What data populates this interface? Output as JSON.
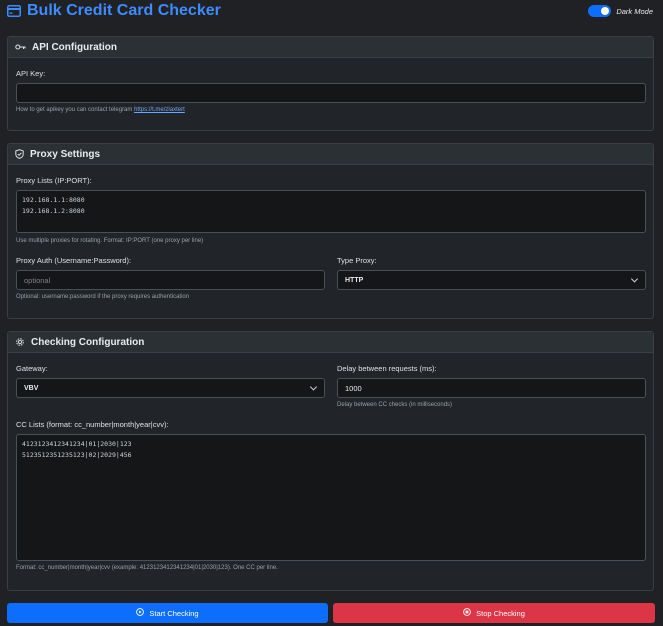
{
  "header": {
    "title": "Bulk Credit Card Checker",
    "dark_mode_label": "Dark Mode",
    "dark_mode_on": true
  },
  "api": {
    "title": "API Configuration",
    "key_label": "API Key:",
    "key_value": "",
    "help_text": "How to get apikey you can contact telegram ",
    "help_link": "https://t.me/zlaxtert"
  },
  "proxy": {
    "title": "Proxy Settings",
    "lists_label": "Proxy Lists (IP:PORT):",
    "lists_value": "192.168.1.1:8080\n192.168.1.2:8080",
    "lists_help": "Use multiple proxies for rotating. Format: IP:PORT (one proxy per line)",
    "auth_label": "Proxy Auth (Username:Password):",
    "auth_placeholder": "optional",
    "auth_help": "Optional: username:password if the proxy requires authentication",
    "type_label": "Type Proxy:",
    "type_value": "HTTP"
  },
  "checking": {
    "title": "Checking Configuration",
    "gateway_label": "Gateway:",
    "gateway_value": "VBV",
    "delay_label": "Delay between requests (ms):",
    "delay_value": "1000",
    "delay_help": "Delay between CC checks (in milliseconds)",
    "cc_label": "CC Lists (format: cc_number|month|year|cvv):",
    "cc_value": "4123123412341234|01|2030|123\n5123512351235123|02|2029|456",
    "cc_help": "Format: cc_number|month|year|cvv (example: 4123123412341234|01|2030|123). One CC per line."
  },
  "actions": {
    "start_label": "Start Checking",
    "stop_label": "Stop Checking"
  },
  "colors": {
    "accent": "#0d6efd",
    "title": "#3d8bfd",
    "danger": "#dc3545",
    "background": "#1f2125"
  }
}
